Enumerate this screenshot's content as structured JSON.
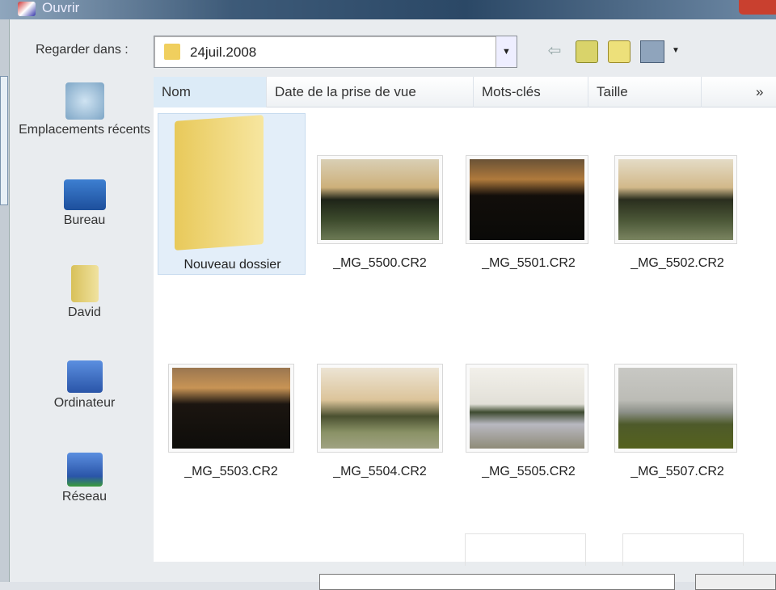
{
  "window": {
    "title": "Ouvrir"
  },
  "toolbar": {
    "look_in_label": "Regarder dans :",
    "location": "24juil.2008",
    "back_icon": "back-arrow-icon",
    "up_icon": "folder-up-icon",
    "new_folder_icon": "new-folder-icon",
    "views_icon": "views-menu-icon"
  },
  "sidebar": {
    "items": [
      {
        "label": "Emplacements récents",
        "icon": "recent-places-icon"
      },
      {
        "label": "Bureau",
        "icon": "desktop-icon"
      },
      {
        "label": "David",
        "icon": "user-folder-icon"
      },
      {
        "label": "Ordinateur",
        "icon": "computer-icon"
      },
      {
        "label": "Réseau",
        "icon": "network-icon"
      }
    ]
  },
  "columns": [
    "Nom",
    "Date de la prise de vue",
    "Mots-clés",
    "Taille",
    "»"
  ],
  "files": [
    {
      "name": "Nouveau dossier",
      "type": "folder"
    },
    {
      "name": "_MG_5500.CR2"
    },
    {
      "name": "_MG_5501.CR2"
    },
    {
      "name": "_MG_5502.CR2"
    },
    {
      "name": "_MG_5503.CR2"
    },
    {
      "name": "_MG_5504.CR2"
    },
    {
      "name": "_MG_5505.CR2"
    },
    {
      "name": "_MG_5507.CR2"
    }
  ]
}
